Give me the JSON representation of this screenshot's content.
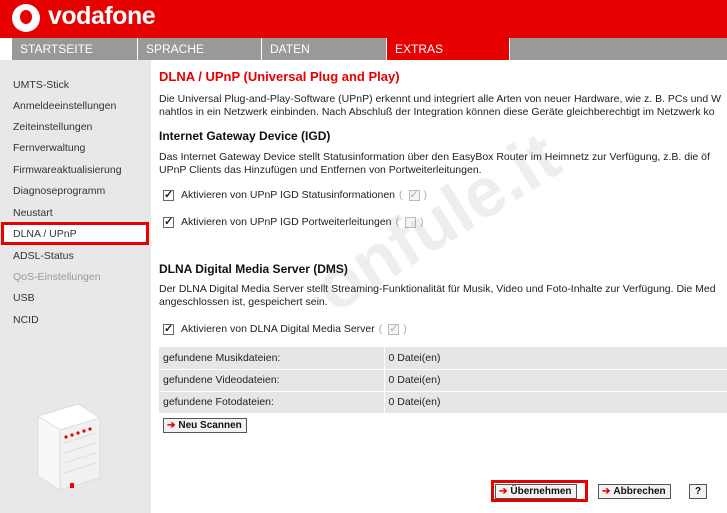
{
  "header": {
    "brand": "vodafone",
    "colors": {
      "brand_red": "#e60000",
      "nav_gray": "#999999"
    }
  },
  "nav": {
    "tabs": [
      {
        "label": "STARTSEITE"
      },
      {
        "label": "SPRACHE"
      },
      {
        "label": "DATEN"
      },
      {
        "label": "EXTRAS",
        "active": true
      }
    ]
  },
  "sidebar": {
    "items": [
      {
        "label": "UMTS-Stick"
      },
      {
        "label": "Anmeldeeinstellungen"
      },
      {
        "label": "Zeiteinstellungen"
      },
      {
        "label": "Fernverwaltung"
      },
      {
        "label": "Firmwareaktualisierung"
      },
      {
        "label": "Diagnoseprogramm"
      },
      {
        "label": "Neustart"
      },
      {
        "label": "DLNA / UPnP",
        "active": true
      },
      {
        "label": "ADSL-Status"
      },
      {
        "label": "QoS-Einstellungen",
        "disabled": true
      },
      {
        "label": "USB"
      },
      {
        "label": "NCID"
      }
    ]
  },
  "main": {
    "title": "DLNA / UPnP (Universal Plug and Play)",
    "intro_line1": "Die Universal Plug-and-Play-Software (UPnP) erkennt und integriert alle Arten von neuer Hardware, wie z. B. PCs und W",
    "intro_line2": "nahtlos in ein Netzwerk einbinden. Nach Abschluß der Integration können diese Geräte gleichberechtigt im Netzwerk ko",
    "igd": {
      "heading": "Internet Gateway Device (IGD)",
      "desc_line1": "Das Internet Gateway Device stellt Statusinformation über den EasyBox Router im Heimnetz zur Verfügung, z.B. die öf",
      "desc_line2": "UPnP Clients das Hinzufügen und Entfernen von Portweiterleitungen.",
      "cb_status_label": "Aktivieren von UPnP IGD Statusinformationen",
      "cb_status_checked": true,
      "cb_ports_label": "Aktivieren von UPnP IGD Portweiterleitungen",
      "cb_ports_checked": true
    },
    "dms": {
      "heading": "DLNA Digital Media Server (DMS)",
      "desc_line1": "Der DLNA Digital Media Server stellt Streaming-Funktionalität für Musik, Video und Foto-Inhalte zur Verfügung. Die Med",
      "desc_line2": "angeschlossen ist, gespeichert sein.",
      "cb_label": "Aktivieren von DLNA Digital Media Server",
      "cb_checked": true,
      "rows": [
        {
          "label": "gefundene Musikdateien:",
          "value": "0 Datei(en)"
        },
        {
          "label": "gefundene Videodateien:",
          "value": "0 Datei(en)"
        },
        {
          "label": "gefundene Fotodateien:",
          "value": "0 Datei(en)"
        }
      ],
      "rescan_label": "Neu Scannen"
    },
    "buttons": {
      "apply": "Übernehmen",
      "cancel": "Abbrechen",
      "help": "?"
    }
  },
  "watermark": "onfule.it"
}
